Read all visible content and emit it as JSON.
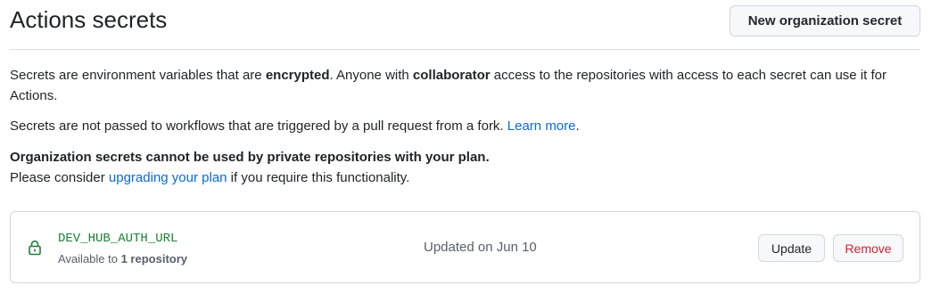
{
  "header": {
    "title": "Actions secrets",
    "new_secret_label": "New organization secret"
  },
  "intro": {
    "p1_a": "Secrets are environment variables that are ",
    "p1_b": "encrypted",
    "p1_c": ". Anyone with ",
    "p1_d": "collaborator",
    "p1_e": " access to the repositories with access to each secret can use it for Actions.",
    "p2_a": "Secrets are not passed to workflows that are triggered by a pull request from a fork. ",
    "p2_link": "Learn more",
    "p2_end": ".",
    "p3": "Organization secrets cannot be used by private repositories with your plan.",
    "p4_a": "Please consider ",
    "p4_link": "upgrading your plan",
    "p4_b": " if you require this functionality."
  },
  "secrets": [
    {
      "name": "DEV_HUB_AUTH_URL",
      "available_prefix": "Available to ",
      "available_count": "1 repository",
      "updated": "Updated on Jun 10",
      "update_label": "Update",
      "remove_label": "Remove",
      "icon": "lock-icon"
    }
  ],
  "colors": {
    "secret_name": "#1a7f37",
    "link": "#0969da",
    "danger": "#cf222e"
  }
}
